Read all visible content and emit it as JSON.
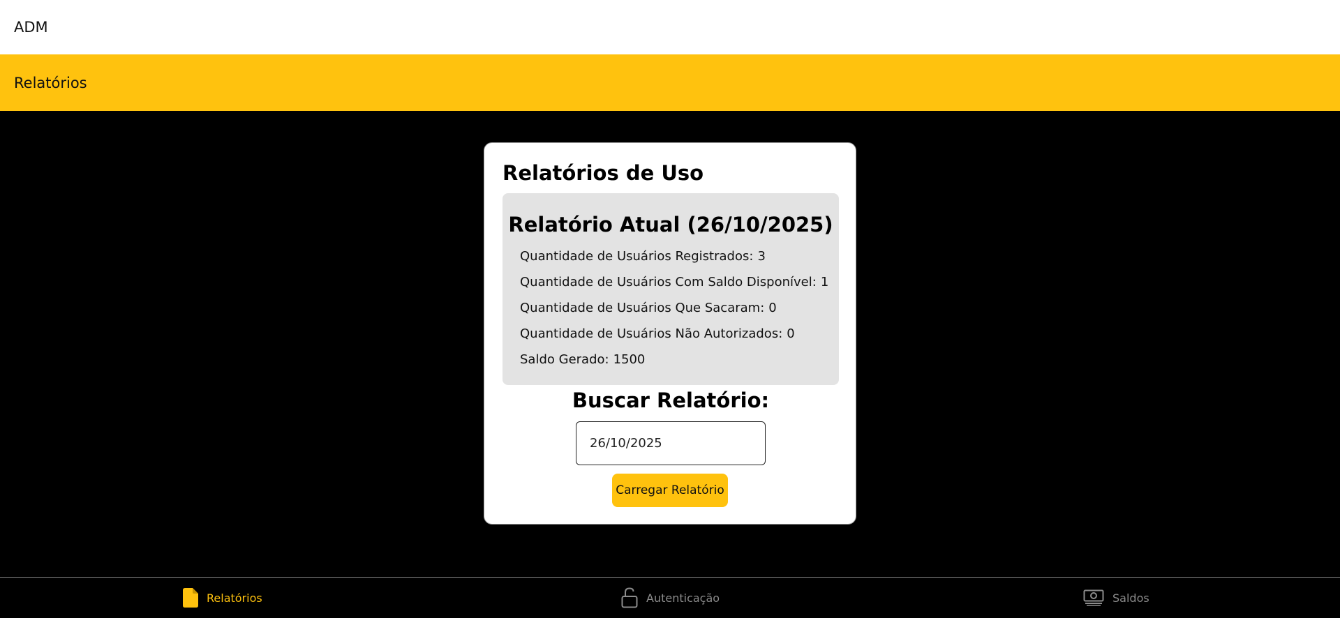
{
  "header": {
    "app_title": "ADM"
  },
  "subheader": {
    "page_title": "Relatórios"
  },
  "card": {
    "title": "Relatórios de Uso",
    "current_report": {
      "title": "Relatório Atual (26/10/2025)",
      "stats": [
        {
          "label": "Quantidade de Usuários Registrados:",
          "value": "3"
        },
        {
          "label": "Quantidade de Usuários Com Saldo Disponível:",
          "value": "1"
        },
        {
          "label": "Quantidade de Usuários Que Sacaram:",
          "value": "0"
        },
        {
          "label": "Quantidade de Usuários Não Autorizados:",
          "value": "0"
        },
        {
          "label": "Saldo Gerado:",
          "value": "1500"
        }
      ]
    },
    "search": {
      "title": "Buscar Relatório:",
      "date_value": "26/10/2025",
      "button_label": "Carregar Relatório"
    }
  },
  "bottom_nav": {
    "items": [
      {
        "label": "Relatórios",
        "icon": "document-icon",
        "active": true
      },
      {
        "label": "Autenticação",
        "icon": "unlock-icon",
        "active": false
      },
      {
        "label": "Saldos",
        "icon": "cash-icon",
        "active": false
      }
    ]
  },
  "colors": {
    "accent": "#ffc20e",
    "inactive_nav": "#8c8c8c",
    "background": "#000000",
    "report_box": "#e3e3e3"
  }
}
